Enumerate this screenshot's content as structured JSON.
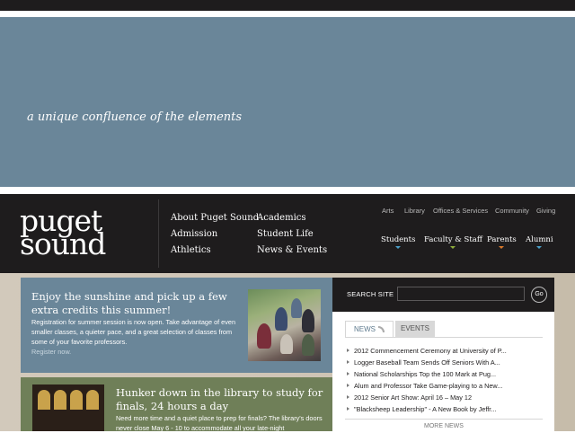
{
  "hero": {
    "tagline": "a unique confluence of the elements"
  },
  "logo": {
    "line1": "puget",
    "line2": "sound"
  },
  "main_nav": {
    "col1": [
      "About Puget Sound",
      "Admission",
      "Athletics"
    ],
    "col2": [
      "Academics",
      "Student Life",
      "News & Events"
    ]
  },
  "utility_nav": [
    "Arts",
    "Library",
    "Offices & Services",
    "Community",
    "Giving"
  ],
  "audience_nav": [
    {
      "label": "Students",
      "color": "#4a9fc9"
    },
    {
      "label": "Faculty & Staff",
      "color": "#8fae3b"
    },
    {
      "label": "Parents",
      "color": "#d9782a"
    },
    {
      "label": "Alumni",
      "color": "#4a9fc9"
    }
  ],
  "features": [
    {
      "title": "Enjoy the sunshine and pick up a few extra credits this summer!",
      "body": "Registration for summer session is now open. Take advantage of even smaller classes, a quieter pace, and a great selection of classes from some of your favorite professors.",
      "link": "Register now."
    },
    {
      "title": "Hunker down in the library to study for finals, 24 hours a day",
      "body": "Need more time and a quiet place to prep for finals? The library's doors never close  May 6 - 10 to accommodate all your late-night"
    }
  ],
  "search": {
    "label": "SEARCH SITE",
    "placeholder": "",
    "button": "Go"
  },
  "news": {
    "tabs": [
      "NEWS",
      "EVENTS"
    ],
    "items": [
      "2012 Commencement Ceremony at University of P...",
      "Logger Baseball Team Sends Off Seniors With A...",
      "National Scholarships Top the 100 Mark at Pug...",
      "Alum and Professor Take Game-playing to a New...",
      "2012 Senior Art Show: April 16 – May 12",
      "\"Blacksheep Leadership\" - A New Book by Jeffr..."
    ],
    "more": "MORE NEWS"
  }
}
